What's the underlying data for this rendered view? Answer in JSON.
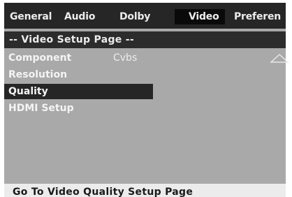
{
  "tabs": [
    {
      "label": "General"
    },
    {
      "label": "Audio"
    },
    {
      "label": "Dolby"
    },
    {
      "label": "Video",
      "active": true
    },
    {
      "label": "Preferen"
    }
  ],
  "page_title": "-- Video Setup Page --",
  "menu": {
    "items": [
      {
        "label": "Component",
        "value": "Cvbs"
      },
      {
        "label": "Resolution"
      },
      {
        "label": "Quality",
        "selected": true
      },
      {
        "label": "HDMI Setup"
      }
    ]
  },
  "icons": {
    "scroll_up": "triangle-up-icon"
  },
  "help_text": "Go To Video Quality Setup Page",
  "colors": {
    "background": "#a9a9a9",
    "tab_bar": "#262626",
    "selected_bg": "#262626",
    "text": "#ececec",
    "help_bar": "#ececec"
  }
}
